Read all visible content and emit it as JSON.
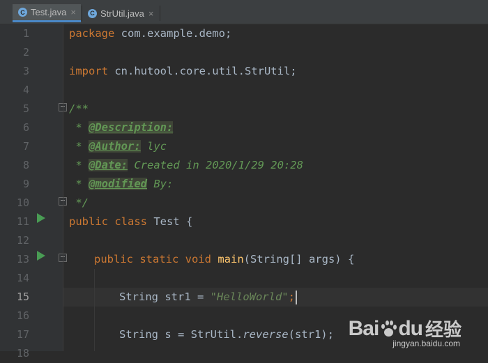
{
  "tabs": [
    {
      "label": "Test.java",
      "active": true,
      "icon": "java-class-icon",
      "close": "×"
    },
    {
      "label": "StrUtil.java",
      "active": false,
      "icon": "java-class-icon",
      "close": "×"
    }
  ],
  "file_icon_glyph": "C",
  "editor": {
    "current_line": 15,
    "lines": [
      {
        "n": "1"
      },
      {
        "n": "2"
      },
      {
        "n": "3"
      },
      {
        "n": "4"
      },
      {
        "n": "5"
      },
      {
        "n": "6"
      },
      {
        "n": "7"
      },
      {
        "n": "8"
      },
      {
        "n": "9"
      },
      {
        "n": "10"
      },
      {
        "n": "11"
      },
      {
        "n": "12"
      },
      {
        "n": "13"
      },
      {
        "n": "14"
      },
      {
        "n": "15"
      },
      {
        "n": "16"
      },
      {
        "n": "17"
      },
      {
        "n": "18"
      }
    ],
    "code": {
      "l1_kw": "package",
      "l1_rest": " com.example.demo;",
      "l3_kw": "import",
      "l3_rest": " cn.hutool.core.util.StrUtil;",
      "l5": "/**",
      "l6_star": " * ",
      "l6_tag": "@Description:",
      "l7_star": " * ",
      "l7_tag": "@Author:",
      "l7_text": " lyc",
      "l8_star": " * ",
      "l8_tag": "@Date:",
      "l8_text": " Created in 2020/1/29 20:28",
      "l9_star": " * ",
      "l9_tag": "@modified",
      "l9_text": " By:",
      "l10": " */",
      "l11_kw": "public class",
      "l11_rest": " Test {",
      "l13_kw": "public static void",
      "l13_fn": "main",
      "l13_rest": "(String[] args) {",
      "l15_pre": "String str1 = ",
      "l15_str": "\"HelloWorld\"",
      "l15_end": ";",
      "l17_pre": "String s = StrUtil.",
      "l17_call": "reverse",
      "l17_end": "(str1);"
    }
  },
  "watermark": {
    "brand": "Bai",
    "brand2": "du",
    "suffix": "经验",
    "url": "jingyan.baidu.com"
  },
  "colors": {
    "background": "#2b2b2b",
    "gutter": "#313335",
    "keyword": "#cc7832",
    "doc": "#629755",
    "string": "#6a8759",
    "run": "#499c54"
  }
}
